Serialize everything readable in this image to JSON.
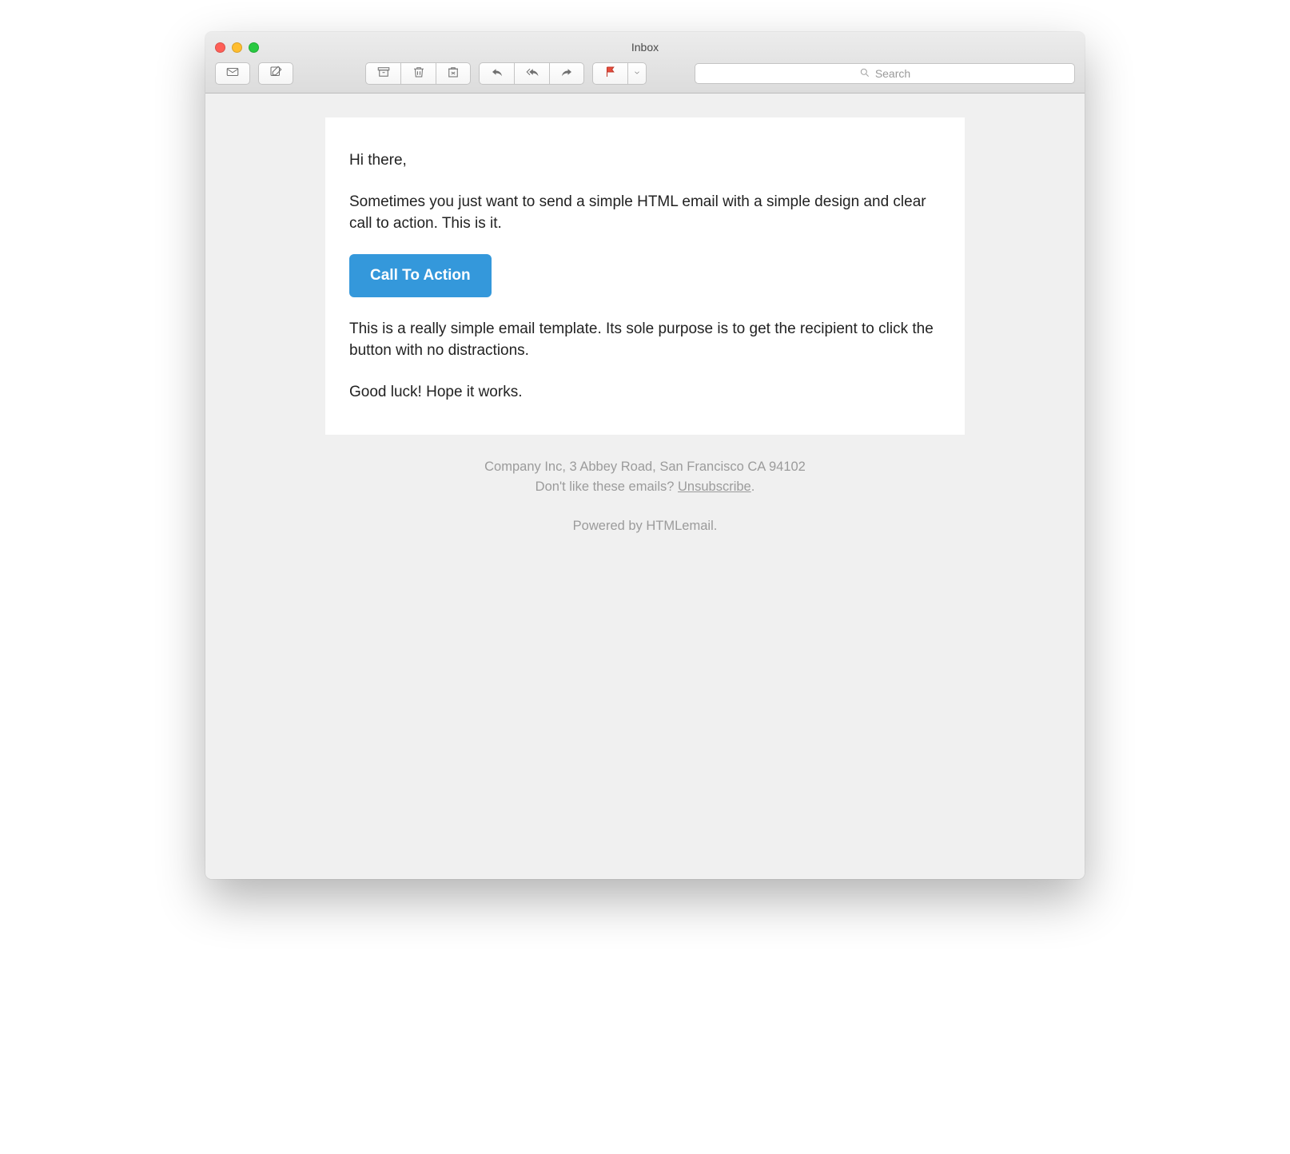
{
  "window": {
    "title": "Inbox"
  },
  "search": {
    "placeholder": "Search"
  },
  "email": {
    "greeting": "Hi there,",
    "intro": "Sometimes you just want to send a simple HTML email with a simple design and clear call to action. This is it.",
    "cta_label": "Call To Action",
    "body": "This is a really simple email template. Its sole purpose is to get the recipient to click the button with no distractions.",
    "closing": "Good luck! Hope it works."
  },
  "footer": {
    "company": "Company Inc, 3 Abbey Road, San Francisco CA 94102",
    "unsub_prefix": "Don't like these emails? ",
    "unsub_link": "Unsubscribe",
    "unsub_suffix": ".",
    "powered": "Powered by HTMLemail."
  },
  "colors": {
    "cta_bg": "#3498db"
  }
}
